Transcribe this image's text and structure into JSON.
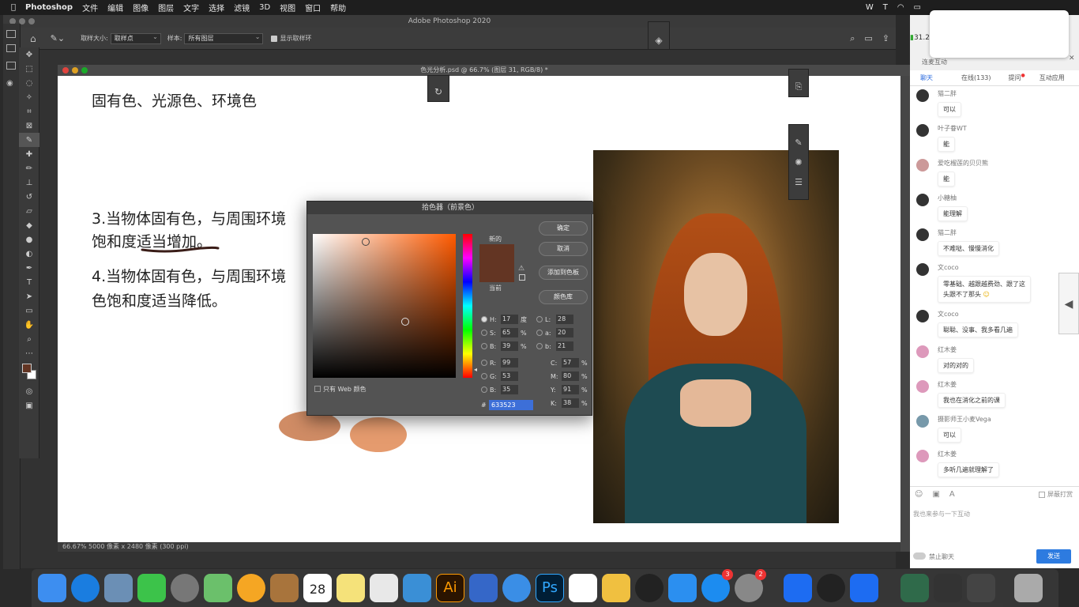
{
  "menubar": {
    "app": "Photoshop",
    "items": [
      "文件",
      "编辑",
      "图像",
      "图层",
      "文字",
      "选择",
      "滤镜",
      "3D",
      "视图",
      "窗口",
      "帮助"
    ]
  },
  "window_title": "Adobe Photoshop 2020",
  "options": {
    "sample_size_label": "取样大小:",
    "sample_size_value": "取样点",
    "sample_label": "样本:",
    "sample_value": "所有图层",
    "show_ring_label": "显示取样环"
  },
  "document": {
    "tab": "色光分析.psd @ 66.7% (图层 31, RGB/8) *",
    "status": "66.67%   5000 像素 x 2480 像素 (300 ppi)"
  },
  "canvas_text": {
    "heading": "固有色、光源色、环境色",
    "line3a": "3.当物体固有色，与周围环境",
    "line3b": "饱和度适当增加。",
    "line4a": "4.当物体固有色，与周围环境",
    "line4b": "色饱和度适当降低。"
  },
  "color_picker": {
    "title": "拾色器（前景色）",
    "new_label": "新的",
    "current_label": "当前",
    "ok": "确定",
    "cancel": "取消",
    "add_swatch": "添加到色板",
    "color_library": "颜色库",
    "web_only": "只有 Web 颜色",
    "fields": [
      {
        "k": "H:",
        "v": "17",
        "u": "度",
        "k2": "L:",
        "v2": "28"
      },
      {
        "k": "S:",
        "v": "65",
        "u": "%",
        "k2": "a:",
        "v2": "20"
      },
      {
        "k": "B:",
        "v": "39",
        "u": "%",
        "k2": "b:",
        "v2": "21"
      }
    ],
    "rgb": [
      {
        "k": "R:",
        "v": "99"
      },
      {
        "k": "G:",
        "v": "53"
      },
      {
        "k": "B:",
        "v": "35"
      }
    ],
    "cmyk": [
      {
        "k": "C:",
        "v": "57"
      },
      {
        "k": "M:",
        "v": "80"
      },
      {
        "k": "Y:",
        "v": "91"
      },
      {
        "k": "K:",
        "v": "38"
      }
    ],
    "percent": "%",
    "hex_label": "#",
    "hex": "633523",
    "color_hex": "#633523"
  },
  "chat": {
    "count": "31.2",
    "subtitle": "连麦互动",
    "tabs": [
      "聊天",
      "在线(133)",
      "提问",
      "互动应用"
    ],
    "messages": [
      {
        "name": "",
        "text": "可以"
      },
      {
        "name": "叶子眷WT",
        "text": "能"
      },
      {
        "name": "爱吃榴莲的贝贝熊",
        "text": "能"
      },
      {
        "name": "小糖柚",
        "text": "能理解"
      },
      {
        "name": "猫二胖",
        "text": "不难哒、慢慢消化"
      },
      {
        "name": "文coco",
        "text": "零基础、越跟越费劲、跟了这"
      },
      {
        "name": "文coco",
        "text": "聪聪、没事、我多看几遍"
      },
      {
        "name": "红木姜",
        "text": "对的对的"
      },
      {
        "name": "红木姜",
        "text": "我也在消化之前的课"
      },
      {
        "name": "摄影师王小麦Vega",
        "text": "可以"
      },
      {
        "name": "红木姜",
        "text": "多听几遍就理解了"
      }
    ],
    "first_name": "猫二胖",
    "msg6_line2": "头跟不了那头",
    "mask_label": "屏蔽打赏",
    "input_placeholder": "我也来参与一下互动",
    "mute_label": "禁止聊天",
    "send": "发送"
  },
  "dock": {
    "calendar_day": "28",
    "badge_a": "3",
    "badge_b": "2",
    "ai_label": "Ai",
    "ps_label": "Ps"
  }
}
